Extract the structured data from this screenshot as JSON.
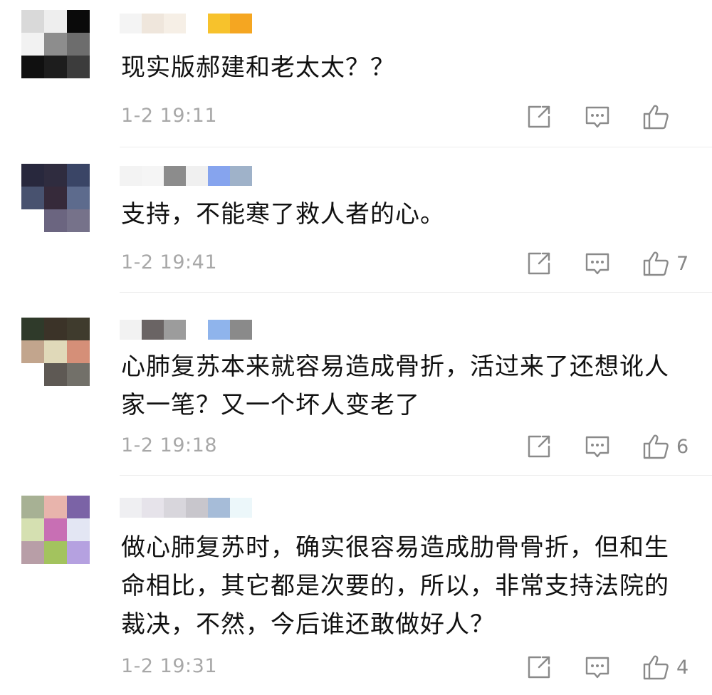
{
  "comments": [
    {
      "text": "现实版郝建和老太太？？",
      "time": "1-2 19:11",
      "likes": "",
      "avatar_colors": [
        "#d9d9d9",
        "#eeeeee",
        "#0a0a0a",
        "#f2f2f2",
        "#8d8d8d",
        "#6d6d6d",
        "#101010",
        "#1d1d1d",
        "#3c3c3c"
      ],
      "name_colors": [
        "#f4f4f4",
        "#efe6dc",
        "#f6efe6",
        "#ffffff",
        "#f7c22c",
        "#f5a621"
      ]
    },
    {
      "text": "支持，不能寒了救人者的心。",
      "time": "1-2 19:41",
      "likes": "7",
      "avatar_colors": [
        "#28283d",
        "#2f2c3f",
        "#3a4566",
        "#48526f",
        "#362a3a",
        "#5d6b8d",
        "#ffffff",
        "#6b6580",
        "#76728a"
      ],
      "name_colors": [
        "#f3f3f3",
        "#f5f5f5",
        "#8c8c8c",
        "#f0f0f0",
        "#86a4ee",
        "#9fb2c9"
      ]
    },
    {
      "text": "心肺复苏本来就容易造成骨折，活过来了还想讹人家一笔？又一个坏人变老了",
      "time": "1-2 19:18",
      "likes": "6",
      "avatar_colors": [
        "#2f3a2a",
        "#3b3328",
        "#3f3b2d",
        "#c2a58d",
        "#e0d9b9",
        "#d58f78",
        "#ffffff",
        "#5e5954",
        "#727069"
      ],
      "name_colors": [
        "#f2f2f2",
        "#6a6464",
        "#9c9c9c",
        "#ffffff",
        "#8fb4ec",
        "#8a8a8a"
      ]
    },
    {
      "text": "做心肺复苏时，确实很容易造成肋骨骨折，但和生命相比，其它都是次要的，所以，非常支持法院的裁决，不然，今后谁还敢做好人？",
      "time": "1-2 19:31",
      "likes": "4",
      "avatar_colors": [
        "#a7b194",
        "#e8b4ac",
        "#7b63a6",
        "#d5e0b1",
        "#c86fb4",
        "#e3e6f3",
        "#b89ea7",
        "#a3c35e",
        "#b5a1e0"
      ],
      "name_colors": [
        "#efeff2",
        "#e6e3ea",
        "#d8d6dc",
        "#c8c6cc",
        "#a6bcd8",
        "#ecf7fa"
      ]
    }
  ],
  "icons": {
    "share": "share-icon",
    "reply": "comment-icon",
    "like": "thumbs-up-icon"
  }
}
